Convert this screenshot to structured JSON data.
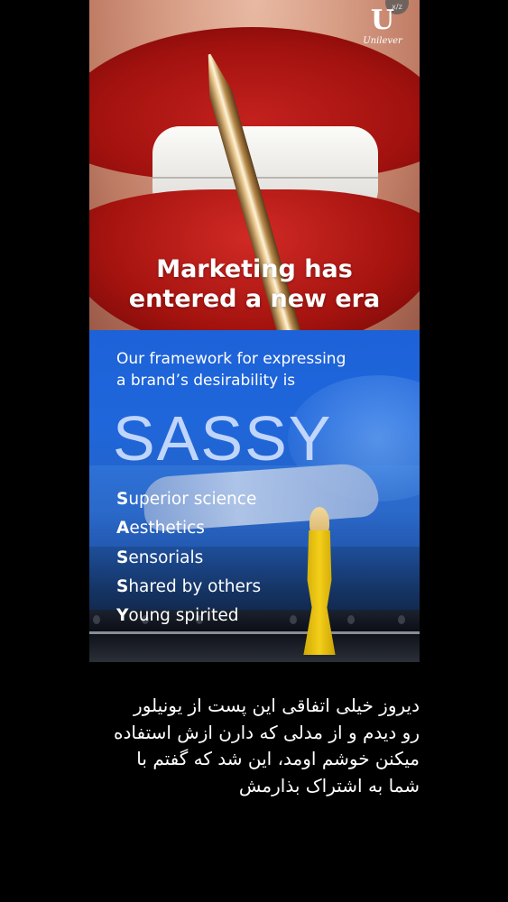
{
  "brand": {
    "logo_mark": "U",
    "logo_text": "Unilever",
    "corner_control": "x/z"
  },
  "headline": {
    "line1": "Marketing has",
    "line2": "entered a new era"
  },
  "framework": {
    "intro_line1": "Our framework for expressing",
    "intro_line2": "a brand’s desirability is",
    "acronym": "SASSY",
    "pillars": [
      {
        "initial": "S",
        "rest": "uperior science"
      },
      {
        "initial": "A",
        "rest": "esthetics"
      },
      {
        "initial": "S",
        "rest": "ensorials"
      },
      {
        "initial": "S",
        "rest": "hared by others"
      },
      {
        "initial": "Y",
        "rest": "oung spirited"
      }
    ]
  },
  "caption": {
    "lines": [
      "دیروز خیلی اتفاقی این پست از یونیلور",
      "رو دیدم و از مدلی که دارن ازش استفاده",
      "میکنن خوشم اومد، این شد که گفتم با",
      "شما به اشتراک بذارمش"
    ]
  },
  "colors": {
    "background": "#000000",
    "lipstick_red": "#a5130f",
    "panel_blue": "#1f66db",
    "dress_yellow": "#f3cf1a"
  }
}
